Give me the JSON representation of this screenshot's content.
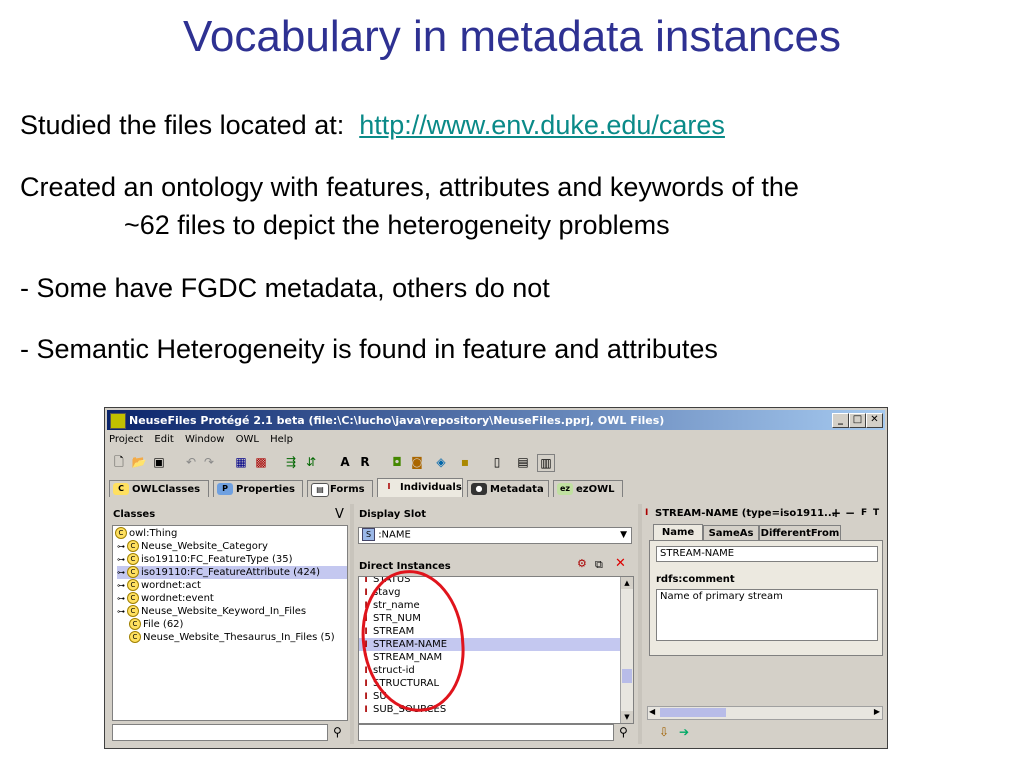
{
  "slide": {
    "title": "Vocabulary in metadata instances",
    "line1_prefix": "Studied the files located at:",
    "line1_link": "http://www.env.duke.edu/cares",
    "line2": "Created an ontology with features, attributes and keywords of the",
    "line2_cont": "~62 files to depict the heterogeneity problems",
    "bullet1": "-  Some have FGDC metadata, others do not",
    "bullet2": "-  Semantic Heterogeneity is found in feature and attributes",
    "accent_color": "#2e3192",
    "link_color": "#0a8a88"
  },
  "window": {
    "title": "NeuseFiles  Protégé 2.1 beta    (file:\\C:\\lucho\\java\\repository\\NeuseFiles.pprj, OWL Files)",
    "min": "_",
    "max": "□",
    "close": "✕",
    "menu": [
      "Project",
      "Edit",
      "Window",
      "OWL",
      "Help"
    ],
    "tabs": [
      {
        "label": "OWLClasses",
        "icon": "C"
      },
      {
        "label": "Properties",
        "icon": "P"
      },
      {
        "label": "Forms",
        "icon": "▤"
      },
      {
        "label": "Individuals",
        "icon": "I"
      },
      {
        "label": "Metadata",
        "icon": "●"
      },
      {
        "label": "ezOWL",
        "icon": "ez"
      }
    ],
    "classes": {
      "header": "Classes",
      "v_label": "V",
      "items": [
        "owl:Thing",
        "Neuse_Website_Category",
        "iso19110:FC_FeatureType  (35)",
        "iso19110:FC_FeatureAttribute  (424)",
        "wordnet:act",
        "wordnet:event",
        "Neuse_Website_Keyword_In_Files",
        "File  (62)",
        "Neuse_Website_Thesaurus_In_Files  (5)"
      ]
    },
    "display_slot": {
      "header": "Display Slot",
      "value": ":NAME"
    },
    "direct_instances": {
      "header": "Direct Instances",
      "items": [
        "STATUS",
        "stavg",
        "str_name",
        "STR_NUM",
        "STREAM",
        "STREAM-NAME",
        "STREAM_NAM",
        "struct-id",
        "STRUCTURAL",
        "SU",
        "SUB_SOURCES"
      ]
    },
    "instance_form": {
      "header": "STREAM-NAME    (type=iso1911...",
      "header_actions": [
        "+",
        "−",
        "F",
        "T"
      ],
      "tabs": [
        "Name",
        "SameAs",
        "DifferentFrom"
      ],
      "name_value": "STREAM-NAME",
      "comment_label": "rdfs:comment",
      "comment_value": "Name of primary stream"
    }
  }
}
